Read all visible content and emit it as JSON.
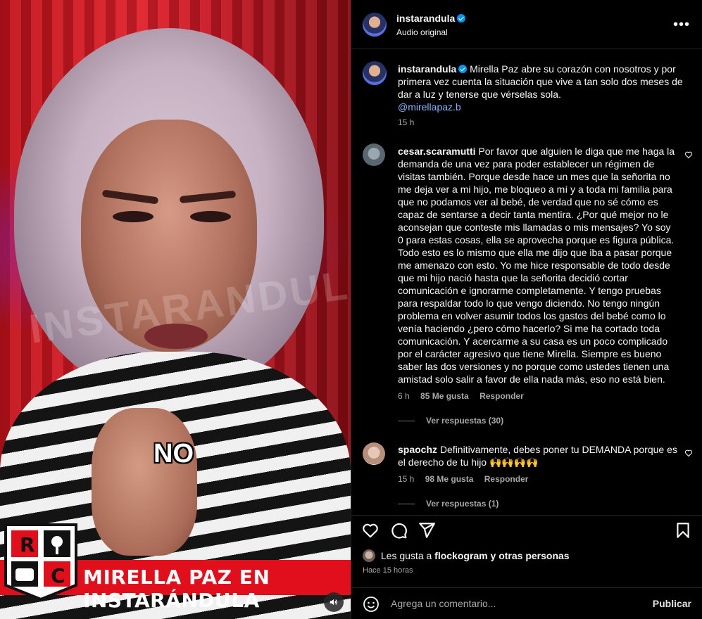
{
  "media": {
    "watermark": "INSTARANDULA",
    "caption_overlay": "NO",
    "banner_text": "MIRELLA PAZ EN INSTARÁNDULA",
    "logo_letters": [
      "R",
      "C"
    ]
  },
  "header": {
    "username": "instarandula",
    "audio": "Audio original",
    "more_icon": "more-horizontal-icon"
  },
  "caption": {
    "username": "instarandula",
    "text": "Mirella Paz abre su corazón con nosotros y por primera vez cuenta la situación que vive a tan solo dos meses de dar a luz y tenerse que vérselas sola.",
    "mention": "@mirellapaz.b",
    "time": "15 h"
  },
  "comments": [
    {
      "username": "cesar.scaramutti",
      "text": "Por favor que alguien le diga que me haga la demanda de una vez para poder establecer un régimen de visitas también. Porque desde hace un mes que la señorita no me deja ver a mi hijo, me bloqueo a mí y a toda mi familia para que no podamos ver al bebé, de verdad que no sé cómo es capaz de sentarse a decir tanta mentira. ¿Por qué mejor no le aconsejan que conteste mis llamadas o mis mensajes? Yo soy 0 para estas cosas, ella se aprovecha porque es figura pública. Todo esto es lo mismo que ella me dijo que iba a pasar porque me amenazo con esto. Yo me hice responsable de todo desde que mi hijo nació hasta que la señorita decidió cortar comunicación e ignorarme completamente. Y tengo pruebas para respaldar todo lo que vengo diciendo. No tengo ningún problema en volver asumir todos los gastos del bebé como lo venía haciendo ¿pero cómo hacerlo? Si me ha cortado toda comunicación. Y acercarme a su casa es un poco complicado por el carácter agresivo que tiene Mirella. Siempre es bueno saber las dos versiones y no porque como ustedes tienen una amistad solo salir a favor de ella nada más, eso no está bien.",
      "time": "6 h",
      "likes": "85 Me gusta",
      "reply": "Responder",
      "view_replies": "Ver respuestas (30)"
    },
    {
      "username": "spaochz",
      "text": "Definitivamente, debes poner tu DEMANDA porque es el derecho de tu hijo 🙌🙌🙌🙌",
      "time": "15 h",
      "likes": "98 Me gusta",
      "reply": "Responder",
      "view_replies": "Ver respuestas (1)"
    }
  ],
  "actions": {
    "icons": [
      "heart-icon",
      "comment-icon",
      "share-icon",
      "bookmark-icon"
    ],
    "likes_prefix": "Les gusta a",
    "likes_user": "flockogram",
    "likes_suffix": "y otras personas",
    "time_ago": "Hace 15 horas"
  },
  "composer": {
    "placeholder": "Agrega un comentario...",
    "publish": "Publicar",
    "emoji_icon": "emoji-icon"
  },
  "colors": {
    "link": "#8ab4f8",
    "muted": "#a8a8a8",
    "verified": "#0095f6",
    "banner": "#e10f1c"
  }
}
